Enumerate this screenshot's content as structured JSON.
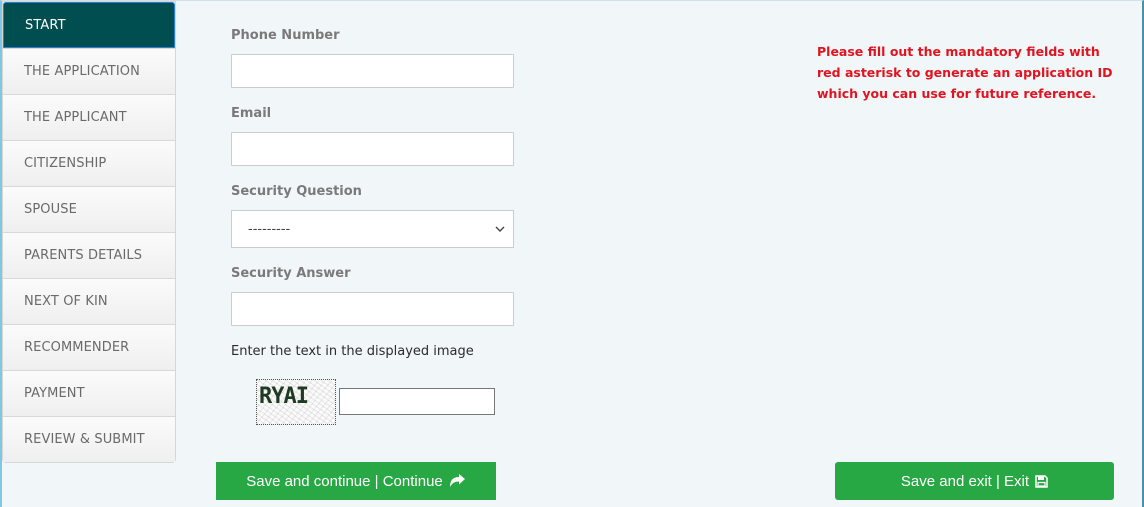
{
  "sidebar": {
    "items": [
      {
        "label": "START",
        "active": true
      },
      {
        "label": "THE APPLICATION"
      },
      {
        "label": "THE APPLICANT"
      },
      {
        "label": "CITIZENSHIP"
      },
      {
        "label": "SPOUSE"
      },
      {
        "label": "PARENTS DETAILS"
      },
      {
        "label": "NEXT OF KIN"
      },
      {
        "label": "RECOMMENDER"
      },
      {
        "label": "PAYMENT"
      },
      {
        "label": "REVIEW & SUBMIT"
      }
    ]
  },
  "form": {
    "phone": {
      "label": "Phone Number",
      "value": ""
    },
    "email": {
      "label": "Email",
      "value": ""
    },
    "security_question": {
      "label": "Security Question",
      "selected": "---------"
    },
    "security_answer": {
      "label": "Security Answer",
      "value": ""
    },
    "captcha": {
      "label": "Enter the text in the displayed image",
      "image_text": "RYAI",
      "value": ""
    }
  },
  "notice": "Please fill out the mandatory fields with red asterisk to generate an application ID which you can use for future reference.",
  "buttons": {
    "continue_label": "Save and continue | Continue",
    "continue_icon": "share-arrow-icon",
    "exit_label": "Save and exit | Exit",
    "exit_icon": "floppy-disk-icon"
  },
  "colors": {
    "active_nav": "#004e4f",
    "button_green": "#28a745",
    "notice_red": "#e0141e"
  }
}
